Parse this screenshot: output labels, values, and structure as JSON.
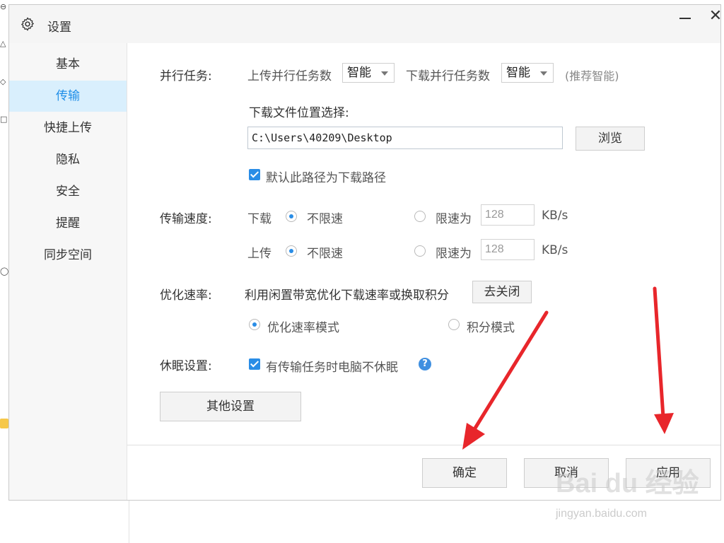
{
  "window": {
    "title": "设置",
    "gear_icon": "gear-icon",
    "minimize_icon": "minimize-icon",
    "close_icon": "close-icon",
    "close_glyph": "✕"
  },
  "sidebar": {
    "items": [
      {
        "label": "基本",
        "active": false
      },
      {
        "label": "传输",
        "active": true
      },
      {
        "label": "快捷上传",
        "active": false
      },
      {
        "label": "隐私",
        "active": false
      },
      {
        "label": "安全",
        "active": false
      },
      {
        "label": "提醒",
        "active": false
      },
      {
        "label": "同步空间",
        "active": false
      }
    ]
  },
  "parallel": {
    "label": "并行任务:",
    "upload_label": "上传并行任务数",
    "upload_value": "智能",
    "download_label": "下载并行任务数",
    "download_value": "智能",
    "hint": "(推荐智能)"
  },
  "download_location": {
    "label": "下载文件位置选择:",
    "path": "C:\\Users\\40209\\Desktop",
    "browse_button": "浏览",
    "default_checkbox_label": "默认此路径为下载路径",
    "default_checked": true
  },
  "speed": {
    "label": "传输速度:",
    "download": {
      "label": "下载",
      "unlimited": "不限速",
      "limit_label": "限速为",
      "limit_value": "128",
      "unit": "KB/s",
      "selected": "unlimited"
    },
    "upload": {
      "label": "上传",
      "unlimited": "不限速",
      "limit_label": "限速为",
      "limit_value": "128",
      "unit": "KB/s",
      "selected": "unlimited"
    }
  },
  "optimize": {
    "label": "优化速率:",
    "description": "利用闲置带宽优化下载速率或换取积分",
    "close_button": "去关闭",
    "mode_speed": "优化速率模式",
    "mode_points": "积分模式",
    "selected": "speed"
  },
  "sleep": {
    "label": "休眠设置:",
    "checkbox_label": "有传输任务时电脑不休眠",
    "checked": true,
    "help_icon": "question-icon",
    "help_glyph": "?"
  },
  "other_button": "其他设置",
  "footer": {
    "ok": "确定",
    "cancel": "取消",
    "apply": "应用"
  },
  "annotation": {
    "arrow_color": "#e8262b"
  },
  "watermark": {
    "main": "Bai du 经验",
    "sub": "jingyan.baidu.com"
  },
  "colors": {
    "accent": "#2a8de6",
    "active_nav_bg": "#d9effd",
    "active_nav_text": "#1f8ee8"
  }
}
